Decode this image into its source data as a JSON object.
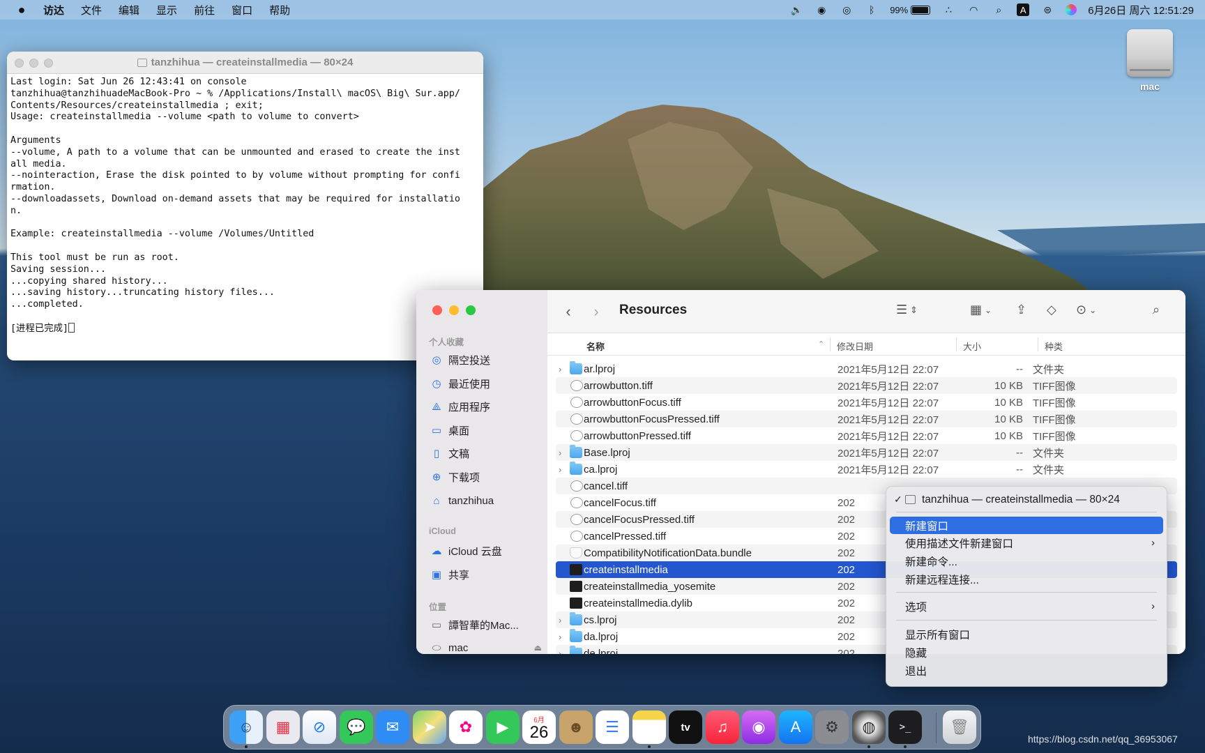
{
  "menubar": {
    "apple_icon": "apple-logo-icon",
    "items": [
      "访达",
      "文件",
      "编辑",
      "显示",
      "前往",
      "窗口",
      "帮助"
    ],
    "battery_percent": "99%",
    "ime_label": "A",
    "clock": "6月26日 周六  12:51:29"
  },
  "desktop": {
    "disk_label": "mac"
  },
  "terminal": {
    "title": "tanzhihua — createinstallmedia — 80×24",
    "content": "Last login: Sat Jun 26 12:43:41 on console\ntanzhihua@tanzhihuadeMacBook-Pro ~ % /Applications/Install\\ macOS\\ Big\\ Sur.app/\nContents/Resources/createinstallmedia ; exit;\nUsage: createinstallmedia --volume <path to volume to convert>\n\nArguments\n--volume, A path to a volume that can be unmounted and erased to create the inst\nall media.\n--nointeraction, Erase the disk pointed to by volume without prompting for confi\nrmation.\n--downloadassets, Download on-demand assets that may be required for installatio\nn.\n\nExample: createinstallmedia --volume /Volumes/Untitled\n\nThis tool must be run as root.\nSaving session...\n...copying shared history...\n...saving history...truncating history files...\n...completed.\n\n[进程已完成]"
  },
  "finder": {
    "title": "Resources",
    "sidebar": {
      "favorites_header": "个人收藏",
      "favorites": [
        {
          "label": "隔空投送",
          "icon": "airdrop-icon"
        },
        {
          "label": "最近使用",
          "icon": "clock-icon"
        },
        {
          "label": "应用程序",
          "icon": "applications-icon"
        },
        {
          "label": "桌面",
          "icon": "desktop-icon"
        },
        {
          "label": "文稿",
          "icon": "document-icon"
        },
        {
          "label": "下载项",
          "icon": "download-icon"
        },
        {
          "label": "tanzhihua",
          "icon": "home-icon"
        }
      ],
      "icloud_header": "iCloud",
      "icloud": [
        {
          "label": "iCloud 云盘",
          "icon": "cloud-icon"
        },
        {
          "label": "共享",
          "icon": "shared-folder-icon"
        }
      ],
      "locations_header": "位置",
      "locations": [
        {
          "label": "譚智華的Mac...",
          "icon": "laptop-icon"
        },
        {
          "label": "mac",
          "icon": "disk-icon"
        }
      ]
    },
    "columns": {
      "name": "名称",
      "date": "修改日期",
      "size": "大小",
      "kind": "种类"
    },
    "files": [
      {
        "name": "ar.lproj",
        "date": "2021年5月12日 22:07",
        "size": "--",
        "kind": "文件夹",
        "type": "folder"
      },
      {
        "name": "arrowbutton.tiff",
        "date": "2021年5月12日 22:07",
        "size": "10 KB",
        "kind": "TIFF图像",
        "type": "tiff"
      },
      {
        "name": "arrowbuttonFocus.tiff",
        "date": "2021年5月12日 22:07",
        "size": "10 KB",
        "kind": "TIFF图像",
        "type": "tiff"
      },
      {
        "name": "arrowbuttonFocusPressed.tiff",
        "date": "2021年5月12日 22:07",
        "size": "10 KB",
        "kind": "TIFF图像",
        "type": "tiff"
      },
      {
        "name": "arrowbuttonPressed.tiff",
        "date": "2021年5月12日 22:07",
        "size": "10 KB",
        "kind": "TIFF图像",
        "type": "tiff"
      },
      {
        "name": "Base.lproj",
        "date": "2021年5月12日 22:07",
        "size": "--",
        "kind": "文件夹",
        "type": "folder"
      },
      {
        "name": "ca.lproj",
        "date": "2021年5月12日 22:07",
        "size": "--",
        "kind": "文件夹",
        "type": "folder"
      },
      {
        "name": "cancel.tiff",
        "date": "",
        "size": "",
        "kind": "",
        "type": "tiff"
      },
      {
        "name": "cancelFocus.tiff",
        "date": "202",
        "size": "",
        "kind": "",
        "type": "tiff"
      },
      {
        "name": "cancelFocusPressed.tiff",
        "date": "202",
        "size": "",
        "kind": "",
        "type": "tiff"
      },
      {
        "name": "cancelPressed.tiff",
        "date": "202",
        "size": "",
        "kind": "",
        "type": "tiff"
      },
      {
        "name": "CompatibilityNotificationData.bundle",
        "date": "202",
        "size": "",
        "kind": "",
        "type": "bundle"
      },
      {
        "name": "createinstallmedia",
        "date": "202",
        "size": "",
        "kind": "",
        "type": "exec",
        "selected": true
      },
      {
        "name": "createinstallmedia_yosemite",
        "date": "202",
        "size": "",
        "kind": "",
        "type": "exec"
      },
      {
        "name": "createinstallmedia.dylib",
        "date": "202",
        "size": "",
        "kind": "",
        "type": "exec"
      },
      {
        "name": "cs.lproj",
        "date": "202",
        "size": "",
        "kind": "",
        "type": "folder"
      },
      {
        "name": "da.lproj",
        "date": "202",
        "size": "",
        "kind": "",
        "type": "folder"
      },
      {
        "name": "de.lproj",
        "date": "202",
        "size": "",
        "kind": "",
        "type": "folder"
      }
    ]
  },
  "context_menu": {
    "window_item": "tanzhihua — createinstallmedia — 80×24",
    "new_window": "新建窗口",
    "new_window_with_profile": "使用描述文件新建窗口",
    "new_command": "新建命令...",
    "new_remote": "新建远程连接...",
    "options": "选项",
    "show_all_windows": "显示所有窗口",
    "hide": "隐藏",
    "quit": "退出"
  },
  "dock": {
    "apps": [
      "Finder",
      "Launchpad",
      "Safari",
      "Messages",
      "Mail",
      "Maps",
      "Photos",
      "FaceTime",
      "Calendar",
      "Contacts",
      "Reminders",
      "Notes",
      "TV",
      "Music",
      "Podcasts",
      "App Store",
      "System Preferences",
      "Install macOS Big Sur",
      "Terminal",
      "Trash"
    ],
    "calendar_month": "6月",
    "calendar_day": "26"
  },
  "watermark": "https://blog.csdn.net/qq_36953067"
}
